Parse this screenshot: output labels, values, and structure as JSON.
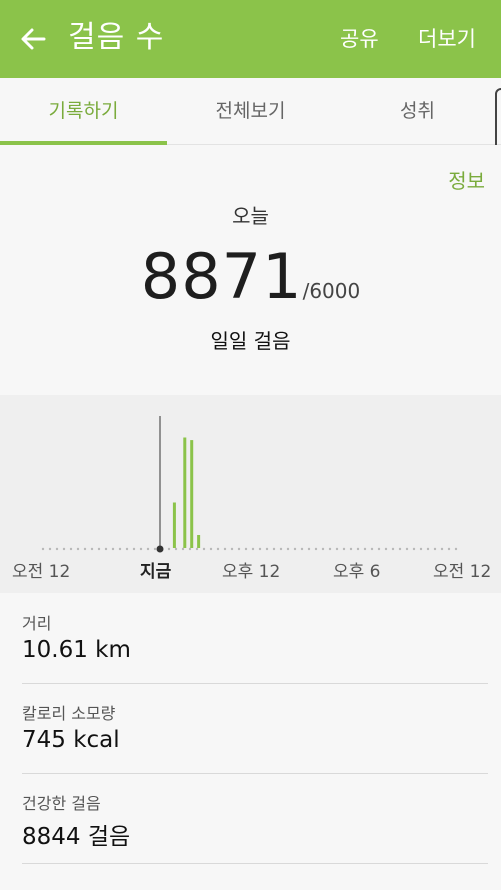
{
  "header": {
    "title": "걸음 수",
    "share_label": "공유",
    "more_label": "더보기",
    "color": "#8bc34a"
  },
  "tabs": [
    {
      "label": "기록하기",
      "active": true
    },
    {
      "label": "전체보기",
      "active": false
    },
    {
      "label": "성취",
      "active": false
    }
  ],
  "summary": {
    "info_label": "정보",
    "today_label": "오늘",
    "steps": "8871",
    "goal": "/6000",
    "daily_label": "일일 걸음"
  },
  "chart_data": {
    "type": "bar",
    "x_labels": [
      "오전 12",
      "지금",
      "오후 12",
      "오후 6",
      "오전 12"
    ],
    "now_index": 1,
    "bars": [
      {
        "hour": 7.6,
        "value": 0.35
      },
      {
        "hour": 8.2,
        "value": 0.85
      },
      {
        "hour": 8.6,
        "value": 0.83
      },
      {
        "hour": 9.0,
        "value": 0.1
      }
    ],
    "color": "#8bc34a"
  },
  "stats": [
    {
      "label": "거리",
      "value": "10.61 km"
    },
    {
      "label": "칼로리 소모량",
      "value": "745 kcal"
    },
    {
      "label": "건강한 걸음",
      "value": "8844 걸음"
    }
  ]
}
